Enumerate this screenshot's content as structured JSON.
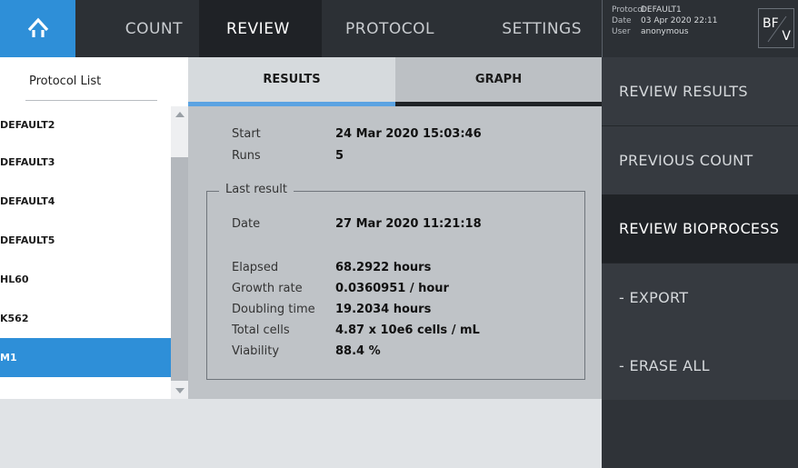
{
  "nav": {
    "home_icon": "home-icon",
    "tabs": [
      "COUNT",
      "REVIEW",
      "PROTOCOL",
      "SETTINGS"
    ],
    "active_tab": "REVIEW"
  },
  "info": {
    "protocol_label": "Protocol",
    "protocol_value": "DEFAULT1",
    "date_label": "Date",
    "date_value": "03 Apr 2020 22:11",
    "user_label": "User",
    "user_value": "anonymous",
    "badge_top": "BF",
    "badge_bottom": "V"
  },
  "protocol_list": {
    "title": "Protocol List",
    "items": [
      "DEFAULT2",
      "DEFAULT3",
      "DEFAULT4",
      "DEFAULT5",
      "HL60",
      "K562",
      "M1"
    ],
    "selected": "M1"
  },
  "view_tabs": {
    "results": "RESULTS",
    "graph": "GRAPH"
  },
  "results": {
    "start_label": "Start",
    "start_value": "24 Mar 2020 15:03:46",
    "runs_label": "Runs",
    "runs_value": "5",
    "group_title": "Last result",
    "date_label": "Date",
    "date_value": "27 Mar 2020 11:21:18",
    "elapsed_label": "Elapsed",
    "elapsed_value": "68.2922 hours",
    "growth_label": "Growth rate",
    "growth_value": "0.0360951 / hour",
    "doubling_label": "Doubling time",
    "doubling_value": "19.2034 hours",
    "total_label": "Total cells",
    "total_value": "4.87 x 10e6 cells / mL",
    "viability_label": "Viability",
    "viability_value": "88.4 %"
  },
  "side_menu": {
    "items": [
      "REVIEW RESULTS",
      "PREVIOUS COUNT",
      "REVIEW BIOPROCESS",
      "- EXPORT",
      "- ERASE ALL"
    ],
    "active": "REVIEW BIOPROCESS"
  },
  "colors": {
    "accent": "#2e8fd8",
    "topbar": "#2c3035",
    "menu": "#363a40"
  }
}
